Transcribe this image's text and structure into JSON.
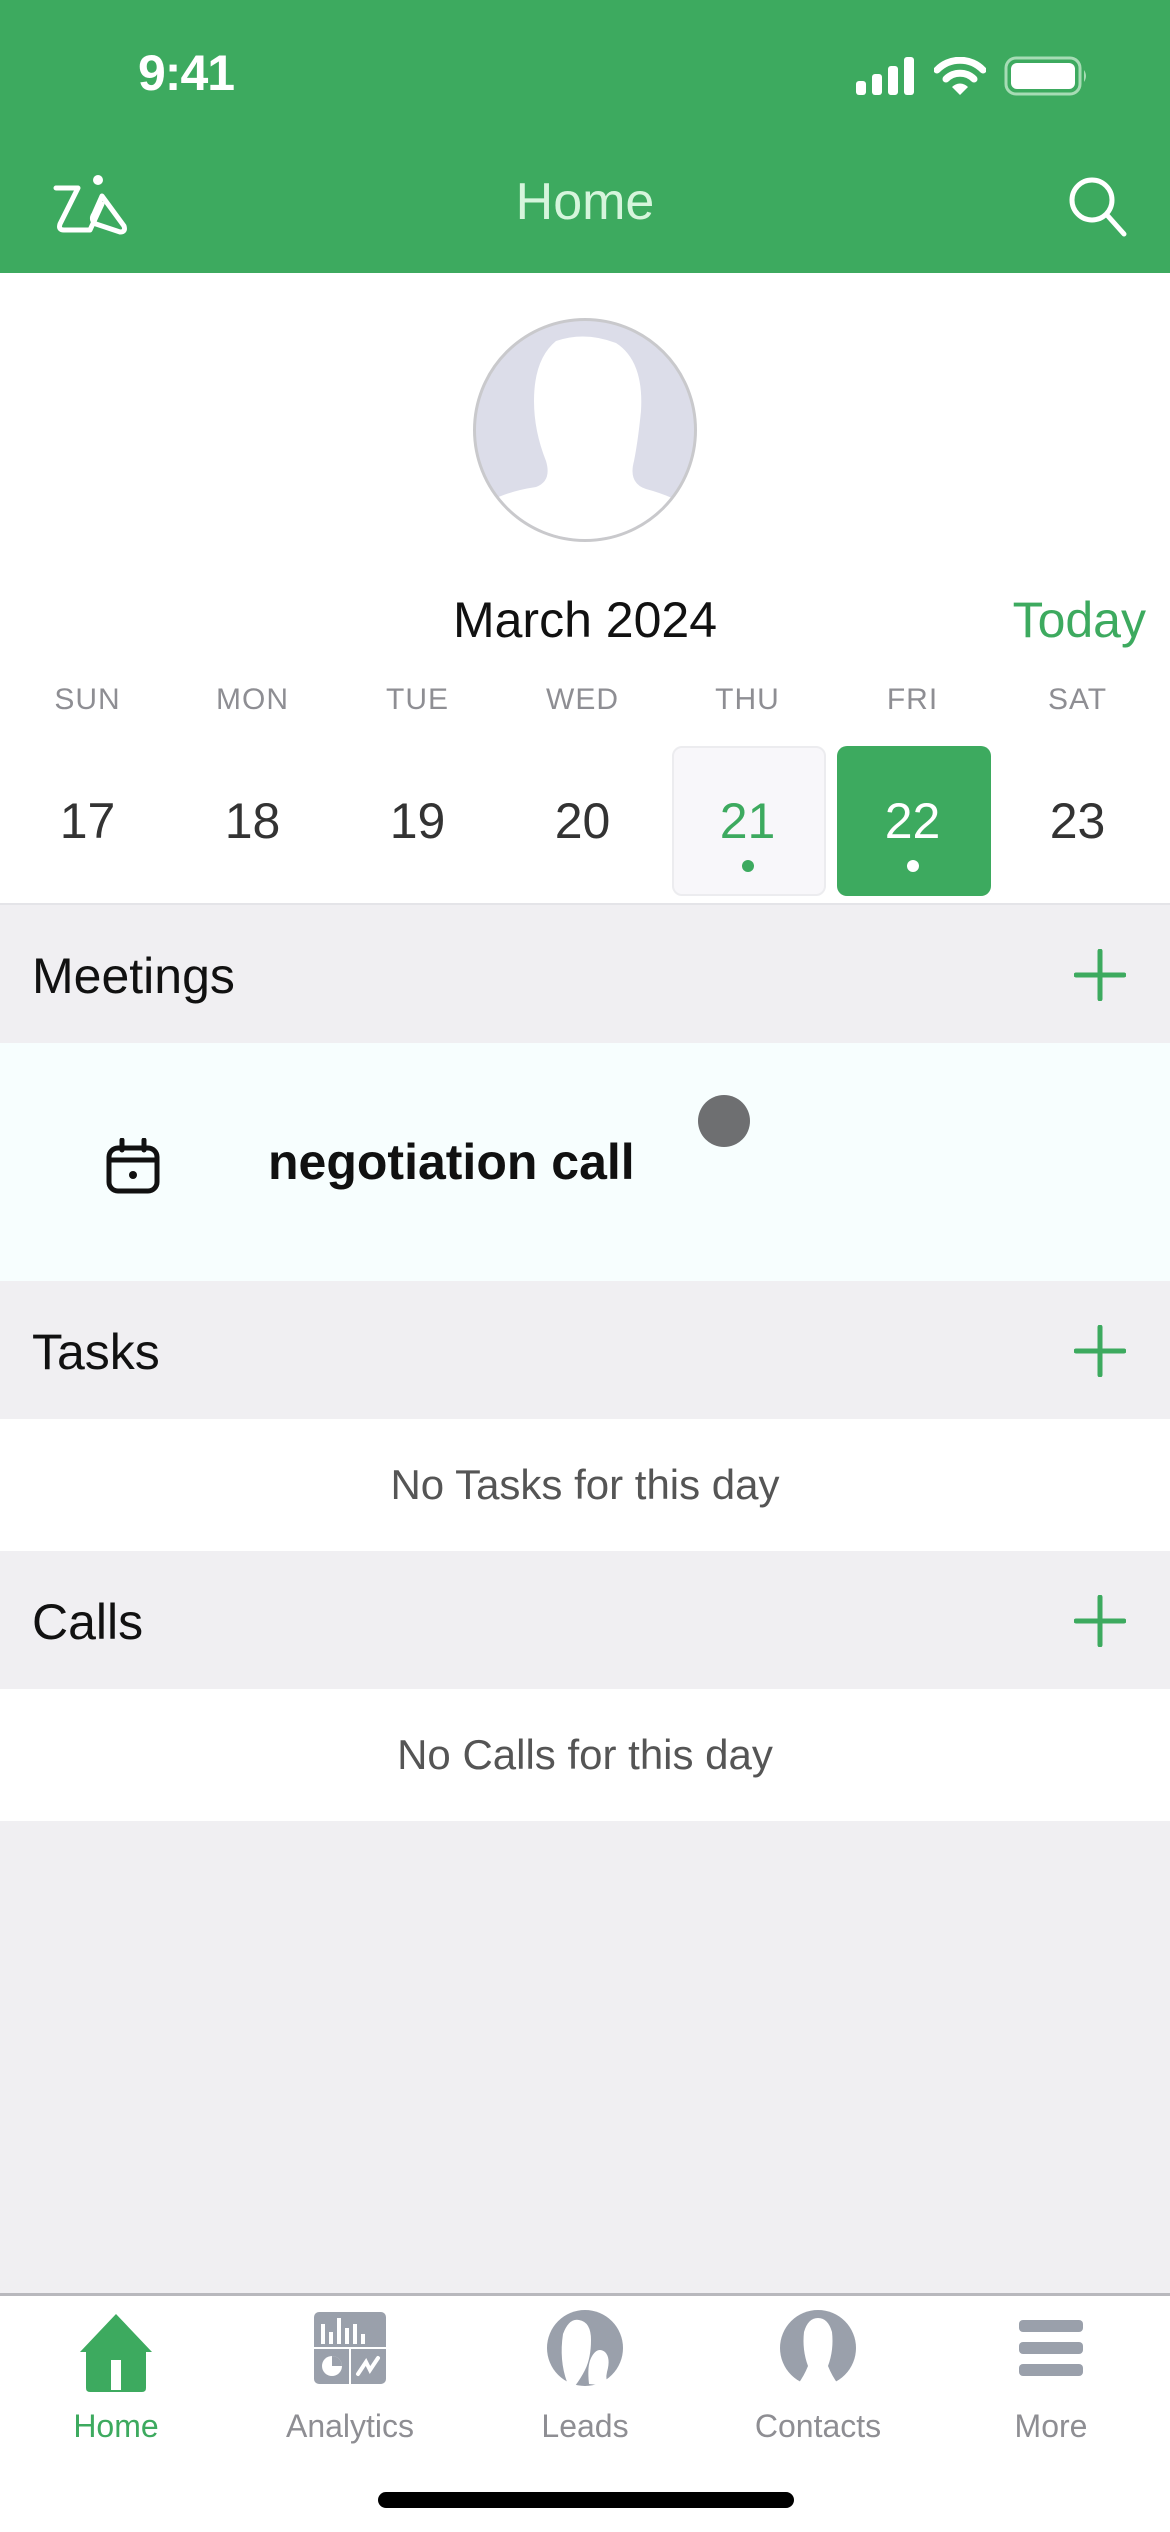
{
  "status_bar": {
    "time": "9:41"
  },
  "header": {
    "title": "Home",
    "left_icon": "zia-icon",
    "right_icon": "search-icon"
  },
  "colors": {
    "accent": "#3daa5f",
    "header_bg": "#3daa5f",
    "section_bg": "#f0eff2",
    "muted_text": "#8e8e93"
  },
  "calendar": {
    "month_label": "March 2024",
    "today_label": "Today",
    "weekdays": [
      "SUN",
      "MON",
      "TUE",
      "WED",
      "THU",
      "FRI",
      "SAT"
    ],
    "dates": [
      {
        "day": "17",
        "state": "normal",
        "has_event": false
      },
      {
        "day": "18",
        "state": "normal",
        "has_event": false
      },
      {
        "day": "19",
        "state": "normal",
        "has_event": false
      },
      {
        "day": "20",
        "state": "normal",
        "has_event": false
      },
      {
        "day": "21",
        "state": "today",
        "has_event": true
      },
      {
        "day": "22",
        "state": "selected",
        "has_event": true
      },
      {
        "day": "23",
        "state": "normal",
        "has_event": false
      }
    ]
  },
  "sections": {
    "meetings": {
      "title": "Meetings",
      "items": [
        {
          "title": "negotiation call",
          "icon": "calendar-icon"
        }
      ]
    },
    "tasks": {
      "title": "Tasks",
      "empty_text": "No Tasks for this day"
    },
    "calls": {
      "title": "Calls",
      "empty_text": "No Calls for this day"
    }
  },
  "tabbar": {
    "items": [
      {
        "label": "Home",
        "icon": "home-icon",
        "active": true
      },
      {
        "label": "Analytics",
        "icon": "analytics-icon",
        "active": false
      },
      {
        "label": "Leads",
        "icon": "leads-icon",
        "active": false
      },
      {
        "label": "Contacts",
        "icon": "contacts-icon",
        "active": false
      },
      {
        "label": "More",
        "icon": "menu-icon",
        "active": false
      }
    ]
  }
}
